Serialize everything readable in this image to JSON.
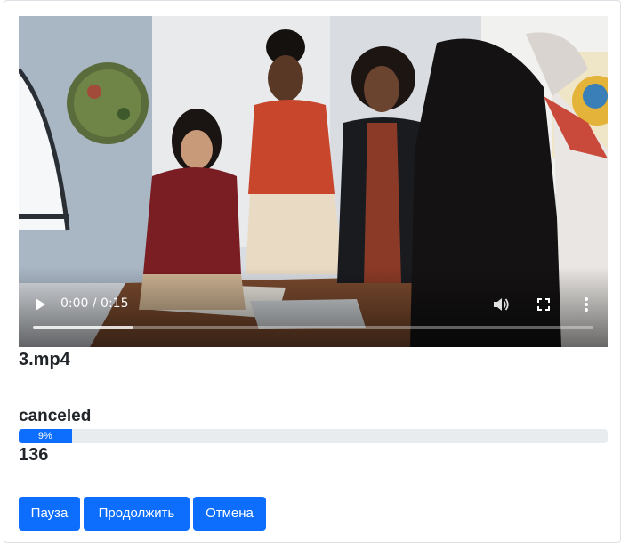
{
  "video": {
    "time_display": "0:00 / 0:15",
    "buffered": 0.18,
    "icons": [
      "play-icon",
      "volume-icon",
      "fullscreen-icon",
      "more-vertical-icon"
    ]
  },
  "upload": {
    "filename": "3.mp4",
    "status": "canceled",
    "progress_label": "9%",
    "progress_percent": 9,
    "count": "136"
  },
  "actions": {
    "pause_label": "Пауза",
    "resume_label": "Продолжить",
    "cancel_label": "Отмена"
  },
  "colors": {
    "primary": "#0d6efd",
    "progress_track": "#e9ecef",
    "card_border": "#dee2e6"
  }
}
